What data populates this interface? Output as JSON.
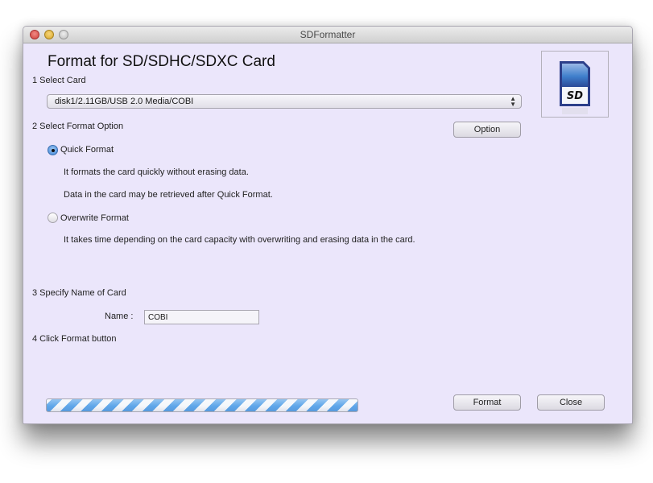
{
  "window": {
    "title": "SDFormatter",
    "controls": [
      "close",
      "minimize",
      "zoom"
    ]
  },
  "heading": "Format for SD/SDHC/SDXC Card",
  "icon": {
    "name": "sd-card-icon",
    "text": "SD"
  },
  "step1": {
    "label": "1 Select Card",
    "selected_card": "disk1/2.11GB/USB 2.0 Media/COBI"
  },
  "step2": {
    "label": "2 Select Format Option",
    "option_button": "Option",
    "quick": {
      "label": "Quick Format",
      "selected": true,
      "desc1": "It formats the card quickly without erasing data.",
      "desc2": "Data in the card may be retrieved after Quick Format."
    },
    "overwrite": {
      "label": "Overwrite Format",
      "selected": false,
      "desc1": "It takes time depending on the card capacity with overwriting and erasing data in the card."
    }
  },
  "step3": {
    "label": "3 Specify Name of Card",
    "name_label": "Name :",
    "name_value": "COBI"
  },
  "step4": {
    "label": "4 Click Format button"
  },
  "progress": {
    "state": "indeterminate"
  },
  "buttons": {
    "format": "Format",
    "close": "Close"
  }
}
